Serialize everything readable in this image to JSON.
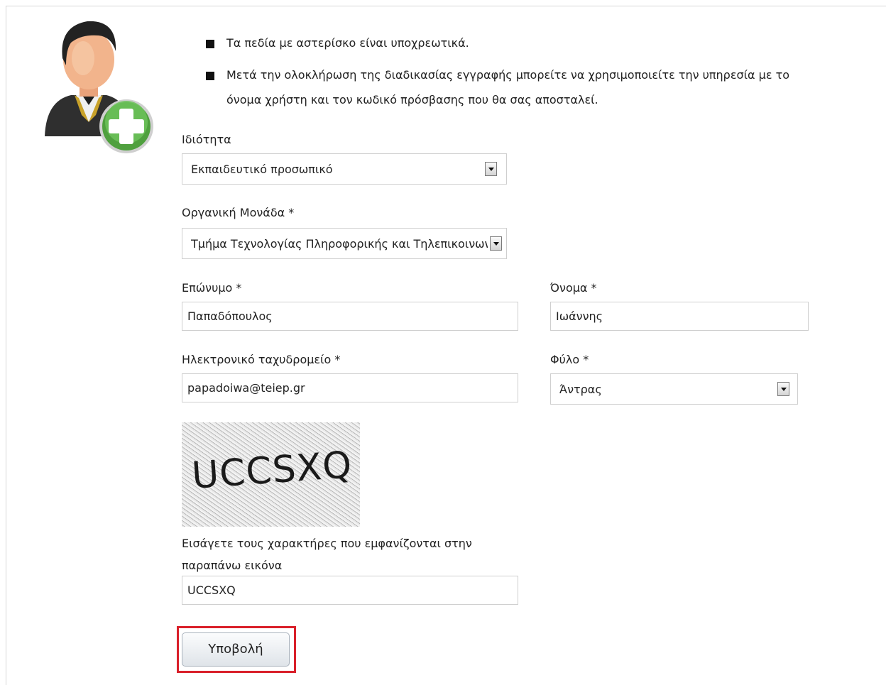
{
  "notes": [
    "Τα πεδία με αστερίσκο είναι υποχρεωτικά.",
    "Μετά την ολοκλήρωση της διαδικασίας εγγραφής μπορείτε να χρησιμοποιείτε την υπηρεσία με το",
    "όνομα χρήστη και τον κωδικό πρόσβασης που θα σας αποσταλεί."
  ],
  "icons": {
    "user_add": "user-add-icon"
  },
  "form": {
    "role": {
      "label": "Ιδιότητα",
      "value": "Εκπαιδευτικό προσωπικό"
    },
    "unit": {
      "label": "Οργανική Μονάδα *",
      "value": "Τμήμα Τεχνολογίας Πληροφορικής και Τηλεπικοινωνιών"
    },
    "surname": {
      "label": "Επώνυμο *",
      "value": "Παπαδόπουλος"
    },
    "name": {
      "label": "Όνομα *",
      "value": "Ιωάννης"
    },
    "email": {
      "label": "Ηλεκτρονικό ταχυδρομείο *",
      "value": "papadoiwa@teiep.gr"
    },
    "gender": {
      "label": "Φύλο *",
      "value": "Άντρας"
    },
    "captcha": {
      "image_text": "UCCSXQ",
      "label_line1": "Εισάγετε τους χαρακτήρες που εμφανίζονται στην",
      "label_line2": "παραπάνω εικόνα",
      "value": "UCCSXQ"
    },
    "submit_label": "Υποβολή"
  },
  "colors": {
    "highlight": "#d9202a",
    "avatar_plus": "#5cae4a"
  }
}
